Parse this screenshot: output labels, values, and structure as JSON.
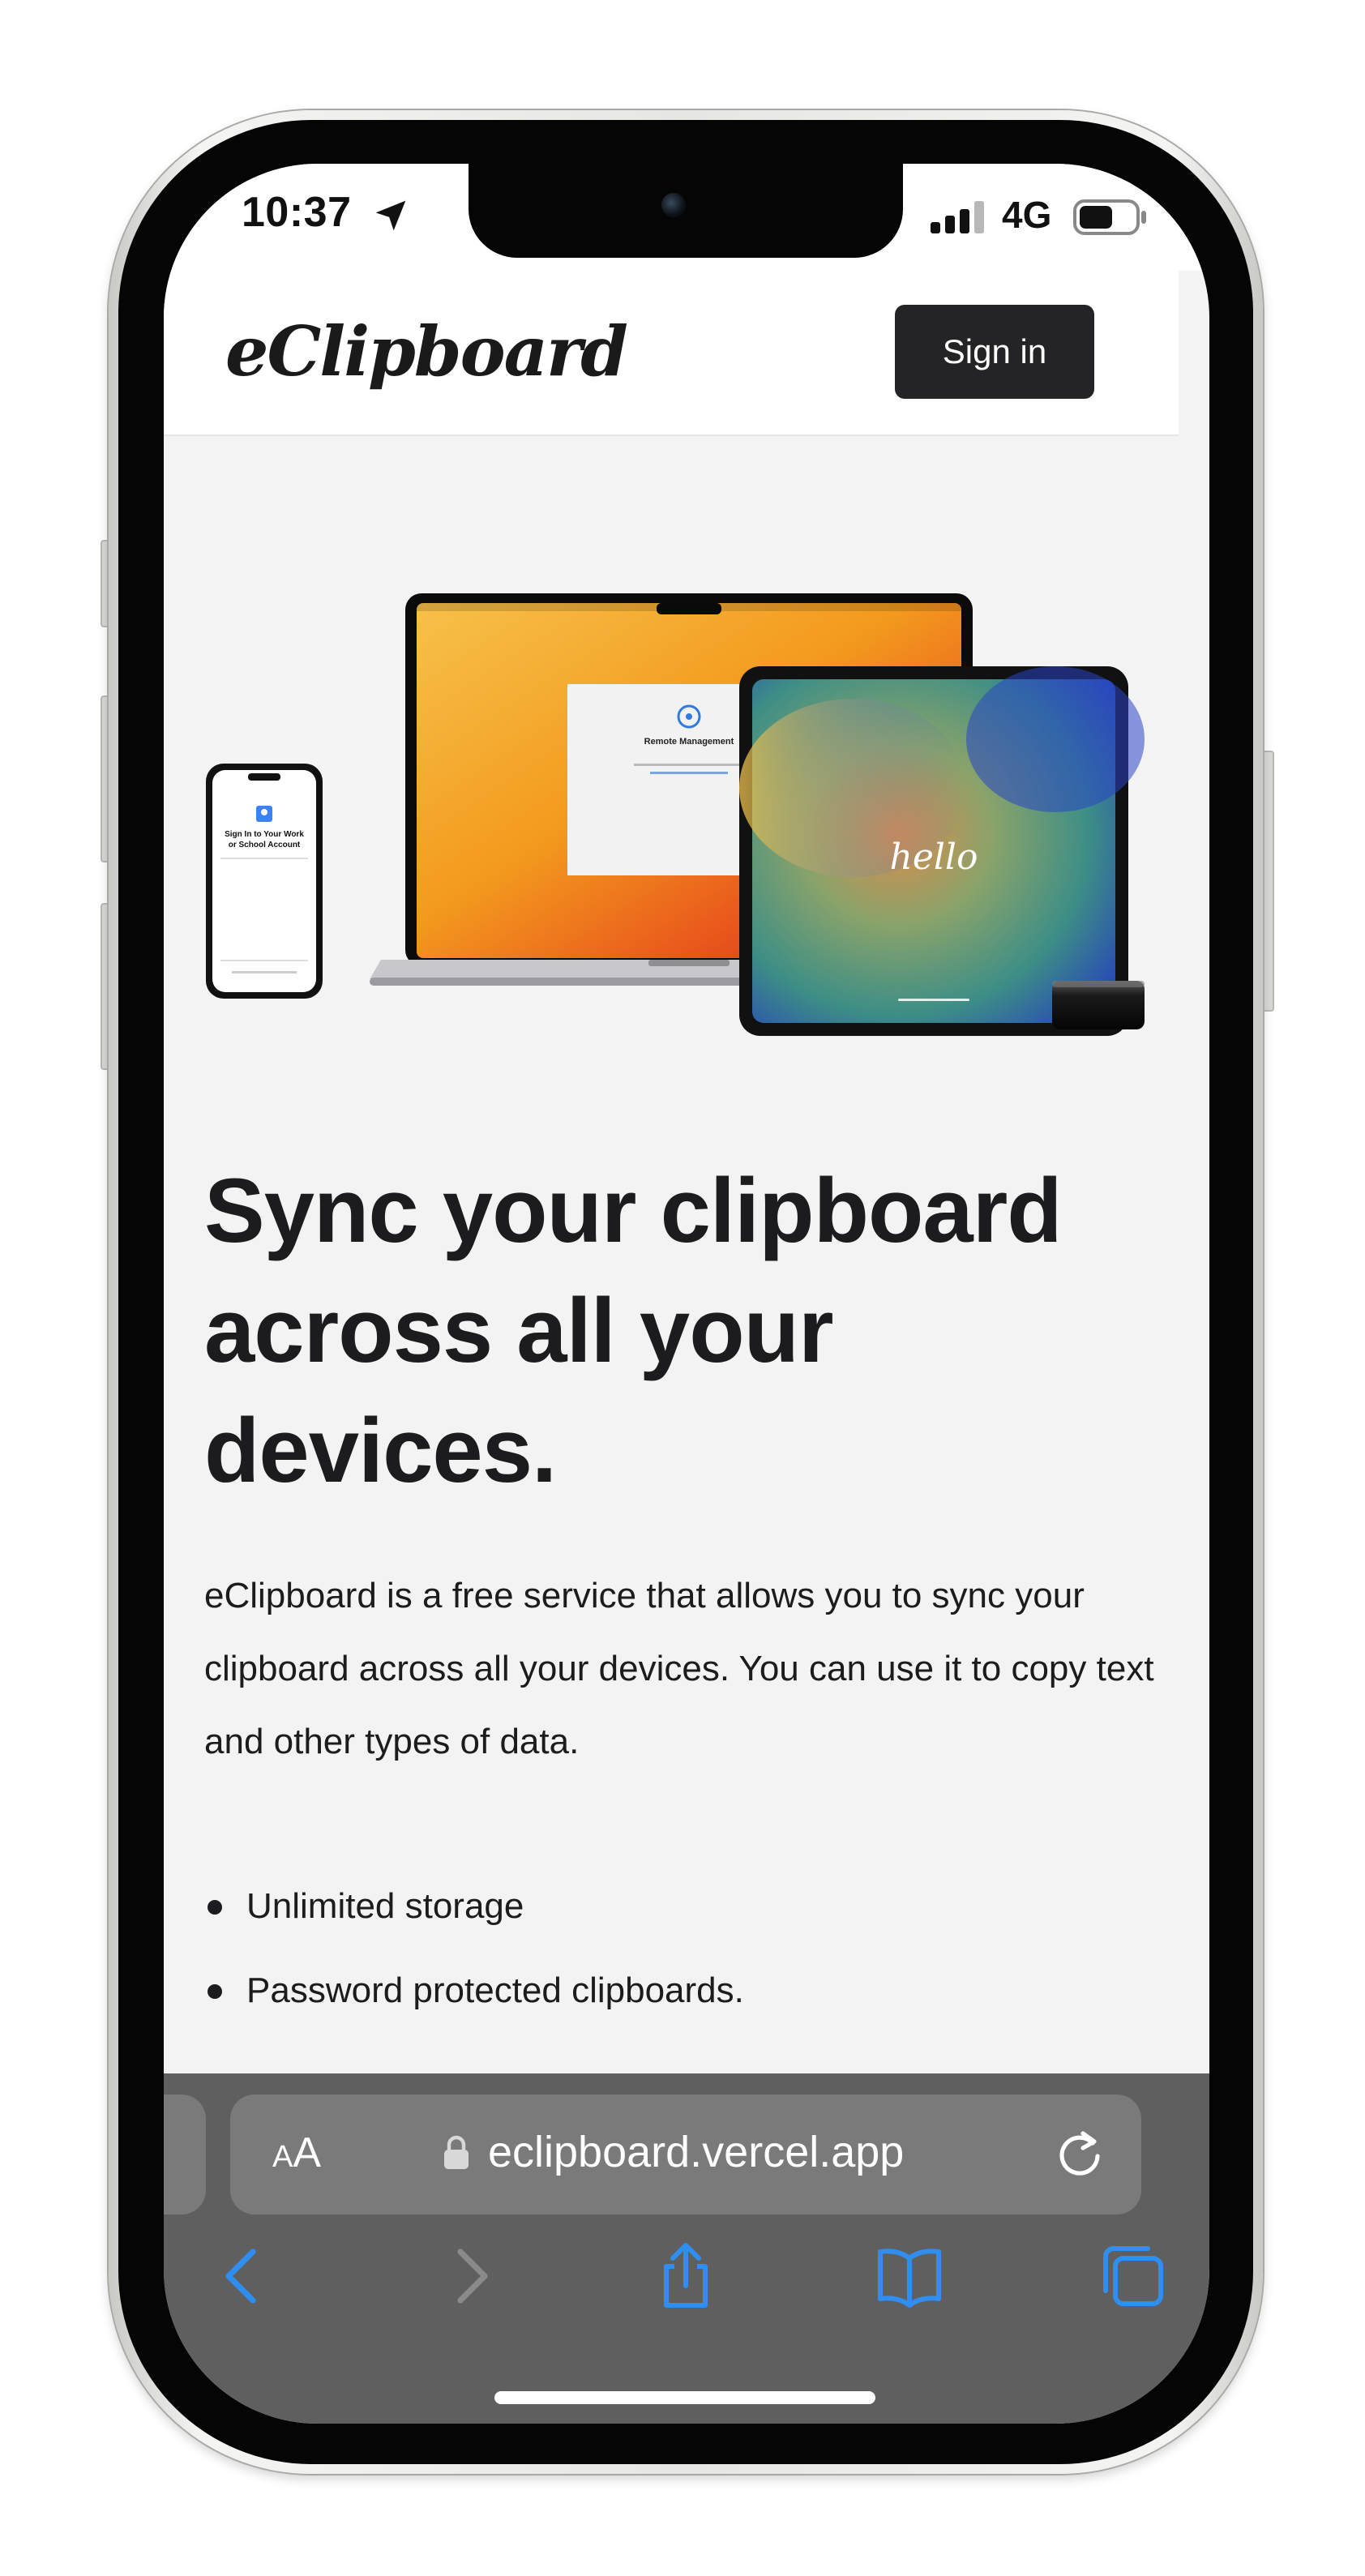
{
  "status_bar": {
    "time": "10:37",
    "network": "4G",
    "icons": [
      "location-arrow-icon",
      "signal-bars-icon",
      "battery-icon"
    ]
  },
  "site_header": {
    "logo": "eClipboard",
    "sign_in_label": "Sign in"
  },
  "hero": {
    "image_label": "devices-illustration",
    "remote_management_title": "Remote Management",
    "phone_signin_text": "Sign In to Your Work or School Account",
    "tablet_greeting": "hello"
  },
  "content": {
    "title": "Sync your clipboard across all your devices.",
    "description": "eClipboard is a free service that allows you to sync your clipboard across all your devices. You can use it to copy text and other types of data.",
    "features": [
      "Unlimited storage",
      "Password protected clipboards."
    ]
  },
  "safari": {
    "text_size_small": "A",
    "text_size_big": "A",
    "url": "eclipboard.vercel.app",
    "toolbar_icons": [
      "back-icon",
      "forward-icon",
      "share-icon",
      "bookmarks-icon",
      "tabs-icon"
    ]
  },
  "colors": {
    "page_background": "#f3f3f3",
    "header_background": "#ffffff",
    "button_dark": "#242426",
    "text_primary": "#1c1c1e",
    "safari_chrome": "#5f5f5f",
    "safari_accent": "#2f8ef0"
  }
}
